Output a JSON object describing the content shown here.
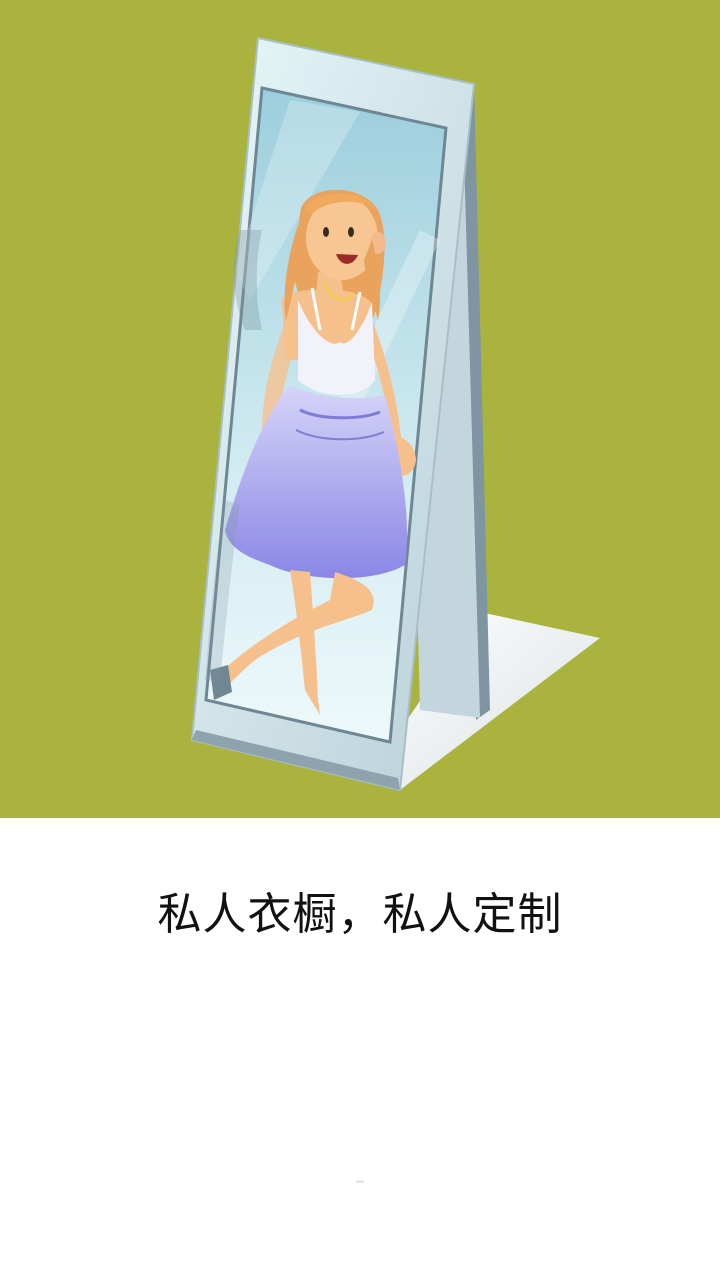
{
  "hero": {
    "background_color": "#a9b33d",
    "illustration": "woman-in-mirror-illustration"
  },
  "caption": {
    "text": "私人衣橱，私人定制"
  },
  "pager": {
    "pages": 1,
    "active_index": 0
  }
}
